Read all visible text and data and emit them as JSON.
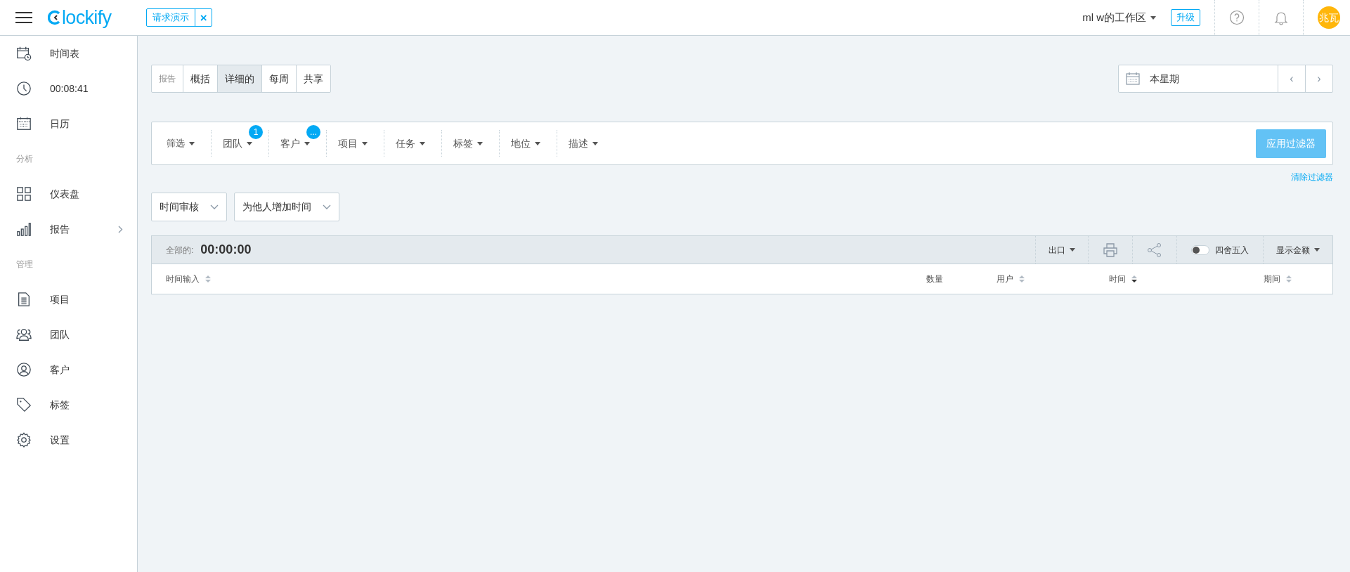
{
  "topbar": {
    "logo": "lockify",
    "demo_button": "请求演示",
    "demo_close": "×",
    "workspace": "ml w的工作区",
    "upgrade": "升级",
    "avatar": "兆瓦"
  },
  "sidebar": {
    "items": [
      {
        "kind": "item",
        "label": "时间表"
      },
      {
        "kind": "item",
        "label": "00:08:41"
      },
      {
        "kind": "item",
        "label": "日历"
      },
      {
        "kind": "section",
        "label": "分析"
      },
      {
        "kind": "item",
        "label": "仪表盘"
      },
      {
        "kind": "item",
        "label": "报告",
        "expandable": true
      },
      {
        "kind": "section",
        "label": "管理"
      },
      {
        "kind": "item",
        "label": "项目"
      },
      {
        "kind": "item",
        "label": "团队"
      },
      {
        "kind": "item",
        "label": "客户"
      },
      {
        "kind": "item",
        "label": "标签"
      },
      {
        "kind": "item",
        "label": "设置"
      }
    ]
  },
  "report_tabs": {
    "label": "报告",
    "tabs": [
      {
        "label": "概括",
        "selected": false
      },
      {
        "label": "详细的",
        "selected": true
      },
      {
        "label": "每周",
        "selected": false
      },
      {
        "label": "共享",
        "selected": false
      }
    ]
  },
  "date_range": {
    "value": "本星期",
    "prev": "‹",
    "next": "›"
  },
  "filters": [
    {
      "label": "筛选"
    },
    {
      "label": "团队",
      "badge": "1"
    },
    {
      "label": "客户",
      "badge": "..."
    },
    {
      "label": "项目"
    },
    {
      "label": "任务"
    },
    {
      "label": "标签"
    },
    {
      "label": "地位"
    },
    {
      "label": "描述"
    }
  ],
  "apply_button": "应用过滤器",
  "clear_link": "清除过滤器",
  "dropdowns": [
    "时间审核",
    "为他人增加时间"
  ],
  "summary": {
    "total_label": "全部的:",
    "total": "00:00:00",
    "export": "出口",
    "rounding_label": "四舍五入",
    "rounding_on": false,
    "show_amount": "显示金额"
  },
  "table": {
    "columns": [
      {
        "label": "时间输入",
        "kind": "sortable",
        "sorted": false
      },
      {
        "label": "数量",
        "kind": "plain"
      },
      {
        "label": "用户",
        "kind": "sortable",
        "sorted": false
      },
      {
        "label": "时间",
        "kind": "sortable",
        "sorted": true
      },
      {
        "label": "期间",
        "kind": "sortable",
        "sorted": false
      }
    ]
  }
}
